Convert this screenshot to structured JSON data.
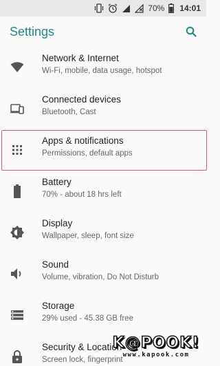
{
  "status_bar": {
    "battery_percent": "70%",
    "time": "14:01",
    "icons": [
      "vibrate-icon",
      "alarm-icon",
      "signal-icon",
      "no-signal-icon",
      "battery-icon"
    ]
  },
  "app_bar": {
    "title": "Settings",
    "search_icon": "search-icon"
  },
  "colors": {
    "accent": "#1f8a7e",
    "highlight_border": "#e25a6a",
    "status_bar_bg": "#e8e8e8",
    "background": "#fafafa"
  },
  "settings_items": [
    {
      "label": "Network & Internet",
      "sub": "Wi-Fi, mobile, data usage, hotspot",
      "icon": "wifi-icon"
    },
    {
      "label": "Connected devices",
      "sub": "Bluetooth, Cast",
      "icon": "devices-icon"
    },
    {
      "label": "Apps & notifications",
      "sub": "Permissions, default apps",
      "icon": "apps-grid-icon",
      "highlighted": true
    },
    {
      "label": "Battery",
      "sub": "70% - about 18 hrs left",
      "icon": "battery-icon"
    },
    {
      "label": "Display",
      "sub": "Wallpaper, sleep, font size",
      "icon": "brightness-icon"
    },
    {
      "label": "Sound",
      "sub": "Volume, vibration, Do Not Disturb",
      "icon": "volume-icon"
    },
    {
      "label": "Storage",
      "sub": "29% used - 45.38 GB free",
      "icon": "storage-icon"
    },
    {
      "label": "Security & Location",
      "sub": "Screen lock, fingerprint",
      "icon": "lock-icon"
    }
  ],
  "watermark": {
    "logo": "K@POOK!",
    "url": "www.kapook.com"
  }
}
